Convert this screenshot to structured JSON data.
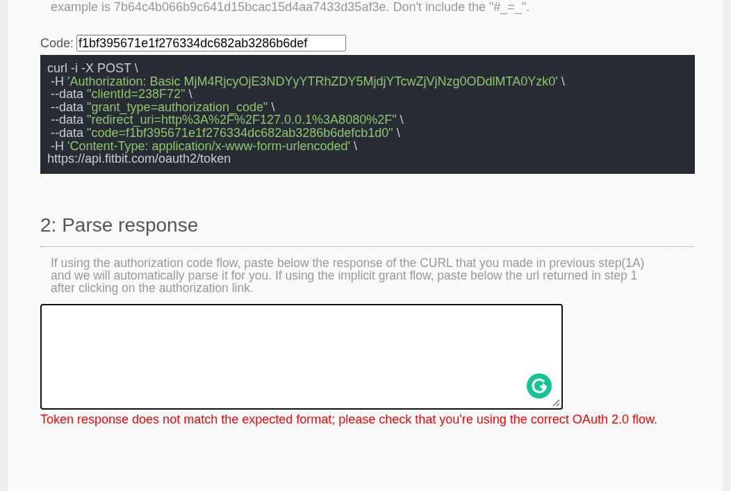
{
  "intro_tail": "example is 7b64c4b066b9c641d15bcac15d4aa7433d35af3e. Don't include the \"#_=_\".",
  "code_field": {
    "label": "Code:",
    "value": "f1bf395671e1f276334dc682ab3286b6def"
  },
  "curl_lines": [
    [
      {
        "kind": "plain",
        "text": "curl -i -X POST \\"
      }
    ],
    [
      {
        "kind": "plain",
        "text": " -H "
      },
      {
        "kind": "string",
        "text": "'Authorization: Basic MjM4RjcyOjE3NDYyYTRhZDY5MjdjYTcwZjVjNzg0ODdlMTA0Yzk0'"
      },
      {
        "kind": "plain",
        "text": " \\"
      }
    ],
    [
      {
        "kind": "plain",
        "text": " --data "
      },
      {
        "kind": "string",
        "text": "\"clientId=238F72\""
      },
      {
        "kind": "plain",
        "text": " \\"
      }
    ],
    [
      {
        "kind": "plain",
        "text": " --data "
      },
      {
        "kind": "string",
        "text": "\"grant_type=authorization_code\""
      },
      {
        "kind": "plain",
        "text": " \\"
      }
    ],
    [
      {
        "kind": "plain",
        "text": " --data "
      },
      {
        "kind": "string",
        "text": "\"redirect_uri=http%3A%2F%2F127.0.0.1%3A8080%2F\""
      },
      {
        "kind": "plain",
        "text": " \\"
      }
    ],
    [
      {
        "kind": "plain",
        "text": " --data "
      },
      {
        "kind": "string",
        "text": "\"code=f1bf395671e1f276334dc682ab3286b6defcb1d0\""
      },
      {
        "kind": "plain",
        "text": " \\"
      }
    ],
    [
      {
        "kind": "plain",
        "text": " -H "
      },
      {
        "kind": "string",
        "text": "'Content-Type: application/x-www-form-urlencoded'"
      },
      {
        "kind": "plain",
        "text": " \\"
      }
    ],
    [
      {
        "kind": "plain",
        "text": "https://api.fitbit.com/oauth2/token"
      }
    ]
  ],
  "section": {
    "title": "2: Parse response",
    "description": "If using the authorization code flow, paste below the response of the CURL that you made in previous step(1A) and we will automatically parse it for you. If using the implicit grant flow, paste below the url returned in step 1 after clicking on the authorization link."
  },
  "response_field": {
    "focused": true
  },
  "error": "Token response does not match the expected format; please check that you're using the correct OAuth 2.0 flow."
}
